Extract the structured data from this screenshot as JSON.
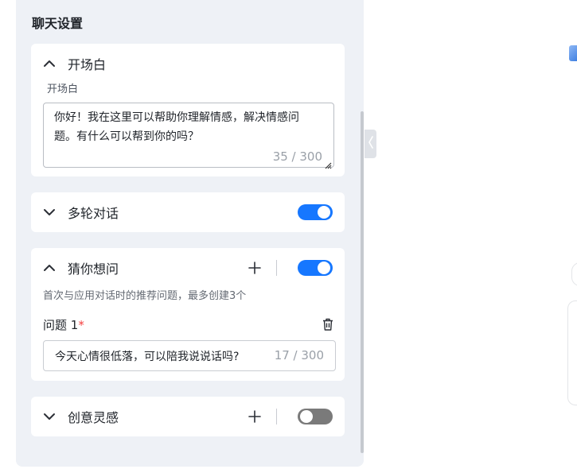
{
  "panel": {
    "title": "聊天设置"
  },
  "opening": {
    "title": "开场白",
    "sub_label": "开场白",
    "text": "你好！我在这里可以帮助你理解情感，解决情感问题。有什么可以帮到你的吗？",
    "counter": "35 / 300"
  },
  "multi_turn": {
    "title": "多轮对话",
    "enabled": true
  },
  "guess": {
    "title": "猜你想问",
    "enabled": true,
    "description": "首次与应用对话时的推荐问题，最多创建3个",
    "question_label": "问题 1",
    "required_mark": "*",
    "question_value": "今天心情很低落，可以陪我说说话吗?",
    "question_counter": "17 / 300"
  },
  "inspiration": {
    "title": "创意灵感",
    "enabled": false
  },
  "colors": {
    "accent": "#1677ff",
    "toggle_off": "#7a7a7a",
    "panel_bg": "#eef1f6"
  },
  "icons": {
    "chevron_up": "chevron-up-icon",
    "chevron_down": "chevron-down-icon",
    "plus": "plus-icon",
    "trash": "trash-icon",
    "collapse": "chevron-left-icon"
  }
}
